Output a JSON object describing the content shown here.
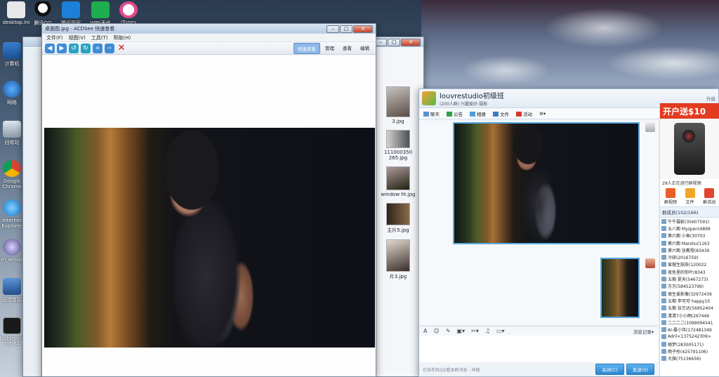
{
  "desktop": {
    "icons": [
      {
        "label": "desktop.ini"
      },
      {
        "label": "腾讯QQ"
      },
      {
        "label": "腾讯管家"
      },
      {
        "label": "WPS表格"
      },
      {
        "label": "iTunes"
      },
      {
        "label": "计算机"
      },
      {
        "label": "网络"
      },
      {
        "label": "回收站"
      },
      {
        "label": "Google Chrome"
      },
      {
        "label": "Internet Explorer"
      },
      {
        "label": "m_windo"
      },
      {
        "label": "宽带连接"
      },
      {
        "label": "Lightroom 5.5 64"
      }
    ]
  },
  "explorer": {
    "thumbs": [
      "3.jpg",
      "111000350 265.jpg",
      "window ht.jpg",
      "主片5.jpg",
      "片3.jpg"
    ]
  },
  "acdsee": {
    "title": "桌面图.jpg - ACDSee 快速查看",
    "menu": [
      "文件(F)",
      "视图(V)",
      "工具(T)",
      "帮助(H)"
    ],
    "tools": [
      "prev-icon",
      "next-icon",
      "rotate-left-icon",
      "rotate-right-icon",
      "zoom-in-icon",
      "zoom-out-icon",
      "delete-icon"
    ],
    "mode_tabs": [
      "快速查看",
      "管理",
      "查看",
      "编辑"
    ],
    "active_tab": "快速查看"
  },
  "qq_group": {
    "name": "louvrestudio初级班",
    "subtitle": "(200人群) 兴趣爱好-摄影",
    "header_right": "升级",
    "tabs": [
      "聊天",
      "公告",
      "相册",
      "文件",
      "活动"
    ],
    "image_label": "",
    "msg_history_label": "消息记录",
    "bottom_hint": "在线手机QQ看本群消息 - 神器",
    "close_btn": "关闭(C)",
    "send_btn": "发送(S)",
    "ad": {
      "headline": "开户送$10",
      "note": "28人正在进行群视频",
      "actions": [
        "群视频",
        "文件",
        "群活动"
      ]
    },
    "members_header": "群成员(102/166)",
    "members": [
      {
        "name": "牛牛摄影(35607591)",
        "tag": ""
      },
      {
        "name": "五八期 Myzpen(4899",
        "tag": ""
      },
      {
        "name": "第六期 小鱼(30703",
        "tag": ""
      },
      {
        "name": "第六期 Marshu(1163",
        "tag": ""
      },
      {
        "name": "第六期 张教授(83439",
        "tag": ""
      },
      {
        "name": "冷研(2016759)",
        "tag": ""
      },
      {
        "name": "爱做生肤肤(120022",
        "tag": ""
      },
      {
        "name": "夜色里的你叶(8343",
        "tag": ""
      },
      {
        "name": "五期 夏天(5467273)",
        "tag": ""
      },
      {
        "name": "万万(584523799)",
        "tag": ""
      },
      {
        "name": "保生爱影像(32972436",
        "tag": ""
      },
      {
        "name": "五期 李可可 happy10",
        "tag": ""
      },
      {
        "name": "五期 张万达(56952404",
        "tag": ""
      },
      {
        "name": "清清7小小雨(267446",
        "tag": ""
      },
      {
        "name": "二二二二(1099094541",
        "tag": ""
      },
      {
        "name": "AI-晏小伟(172481349",
        "tag": ""
      },
      {
        "name": "Adril<1375242309>",
        "tag": ""
      },
      {
        "name": "随梦(283005171)",
        "tag": ""
      },
      {
        "name": "雨子彤(425791106)",
        "tag": ""
      },
      {
        "name": "大旗(75136656)",
        "tag": ""
      }
    ]
  }
}
